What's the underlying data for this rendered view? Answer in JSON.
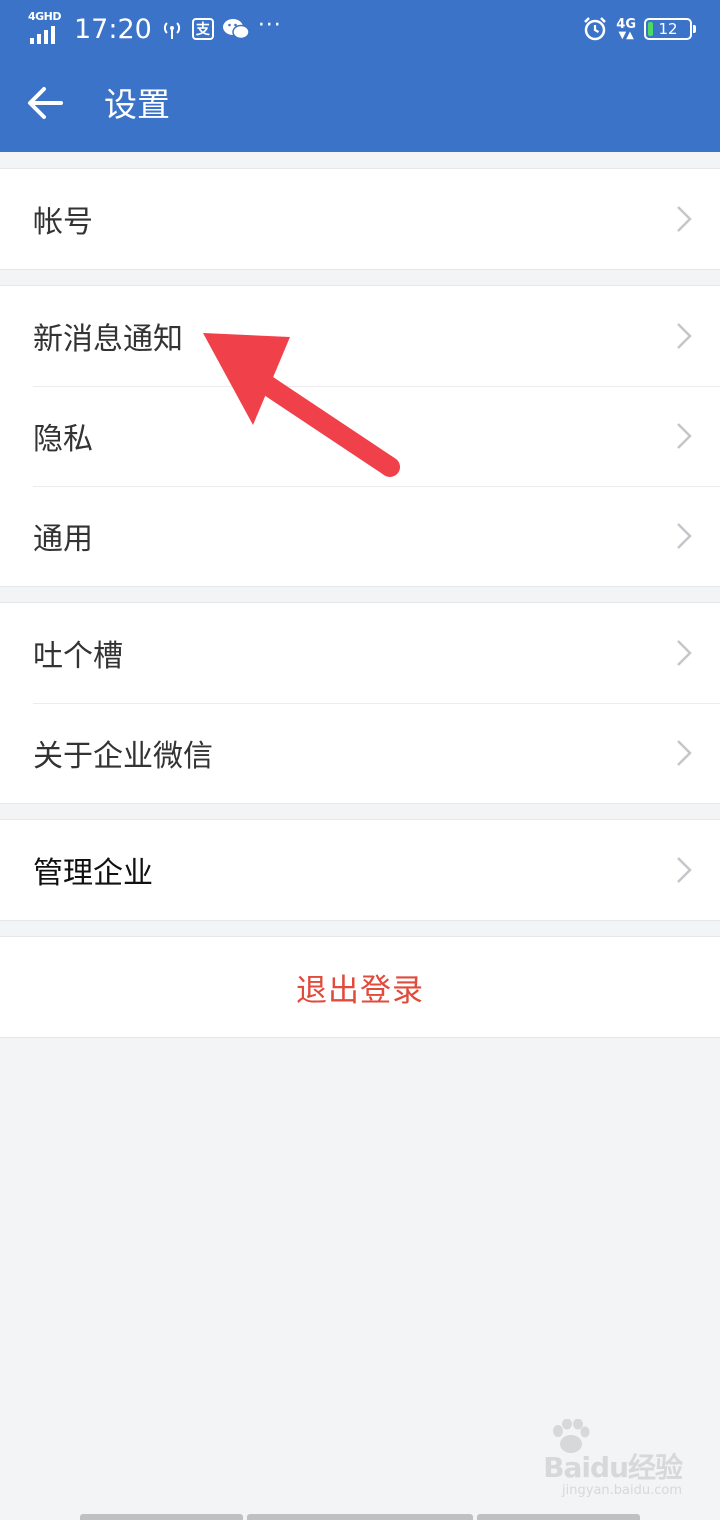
{
  "statusbar": {
    "network_type": "4GHD",
    "time": "17:20",
    "alipay_glyph": "支",
    "more_dots": "···",
    "net_label": "4G",
    "battery_level": "12",
    "battery_fraction": 0.12
  },
  "header": {
    "title": "设置",
    "background": "#3b73c8"
  },
  "groups": [
    {
      "items": [
        {
          "label": "帐号"
        }
      ]
    },
    {
      "items": [
        {
          "label": "新消息通知"
        },
        {
          "label": "隐私"
        },
        {
          "label": "通用"
        }
      ]
    },
    {
      "items": [
        {
          "label": "吐个槽"
        },
        {
          "label": "关于企业微信"
        }
      ]
    },
    {
      "items": [
        {
          "label": "管理企业"
        }
      ]
    }
  ],
  "logout": {
    "label": "退出登录",
    "color": "#e04b3c"
  },
  "annotation": {
    "color": "#f0414b",
    "icon": "red-pointer-arrow-icon"
  },
  "watermark": {
    "main": "Baidu经验",
    "sub": "jingyan.baidu.com"
  }
}
